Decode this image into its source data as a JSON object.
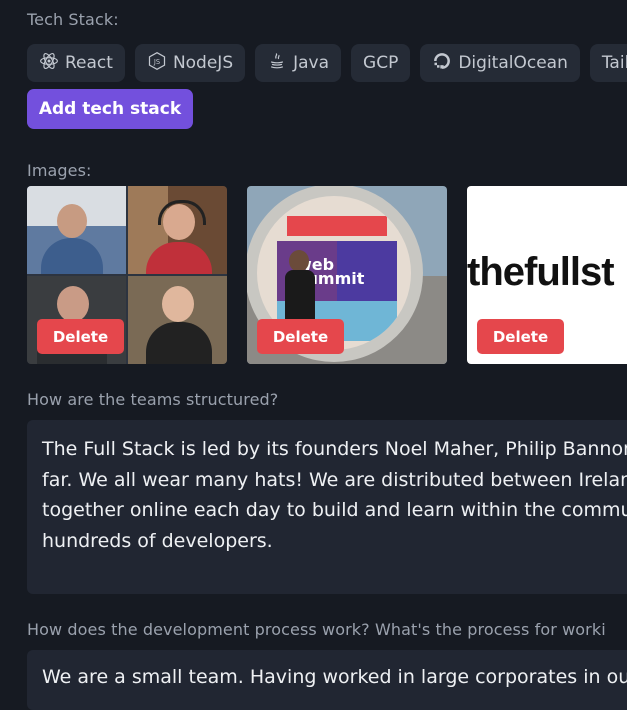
{
  "tech_stack": {
    "label": "Tech Stack:",
    "chips": [
      {
        "label": "React",
        "icon": "react-icon"
      },
      {
        "label": "NodeJS",
        "icon": "nodejs-icon"
      },
      {
        "label": "Java",
        "icon": "java-icon"
      },
      {
        "label": "GCP",
        "icon": ""
      },
      {
        "label": "DigitalOcean",
        "icon": "digitalocean-icon"
      },
      {
        "label": "Tailwin",
        "icon": ""
      }
    ],
    "add_button": "Add tech stack"
  },
  "images": {
    "label": "Images:",
    "items": [
      {
        "delete_label": "Delete"
      },
      {
        "delete_label": "Delete",
        "sign_text": "web summit"
      },
      {
        "delete_label": "Delete",
        "logo_text": "thefullst"
      }
    ]
  },
  "questions": [
    {
      "label": "How are the teams structured?",
      "answer_lines": [
        "The Full Stack is led by its founders Noel Maher, Philip Bannon",
        "far. We all wear many hats! We are distributed between Ireland",
        "together online each day to build and learn within the commun",
        "hundreds of developers."
      ]
    },
    {
      "label": "How does the development process work? What's the process for worki",
      "answer_lines": [
        "We are a small team. Having worked in large corporates in our"
      ]
    }
  ],
  "colors": {
    "background": "#161a22",
    "accent": "#7350dd",
    "danger": "#e5474c",
    "chip": "#252b36",
    "textbox": "#212632"
  }
}
